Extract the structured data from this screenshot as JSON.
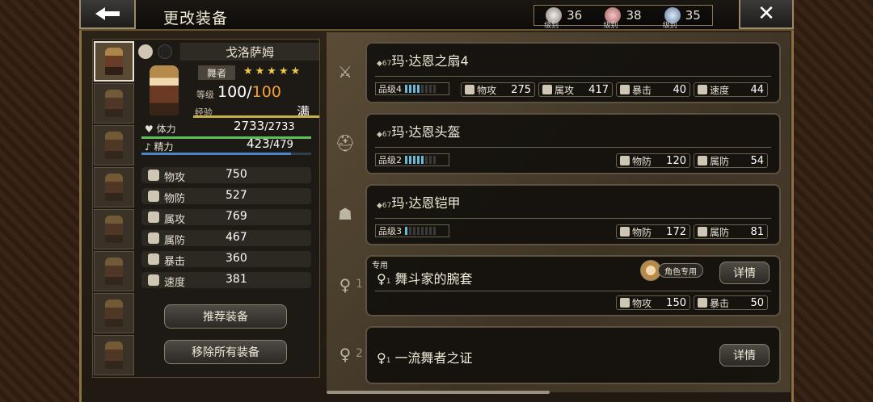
{
  "header": {
    "title": "更改装备",
    "back_icon": "back-arrow-icon",
    "close_icon": "close-icon",
    "levels": [
      {
        "caption": "级别",
        "value": "36"
      },
      {
        "caption": "级别",
        "value": "38"
      },
      {
        "caption": "级别",
        "value": "35"
      }
    ]
  },
  "character": {
    "name": "戈洛萨姆",
    "job": "舞者",
    "stars": "★★★★★",
    "level_label": "等级",
    "level": "100",
    "level_sep": "/",
    "level_max": "100",
    "exp_label": "经验",
    "exp_status": "满",
    "hp_label": "体力",
    "hp": "2733",
    "hp_max": "/2733",
    "mp_label": "精力",
    "mp": "423",
    "mp_max": "/479",
    "mp_fraction": 0.88
  },
  "stats": [
    {
      "label": "物攻",
      "value": "750"
    },
    {
      "label": "物防",
      "value": "527"
    },
    {
      "label": "属攻",
      "value": "769"
    },
    {
      "label": "属防",
      "value": "467"
    },
    {
      "label": "暴击",
      "value": "360"
    },
    {
      "label": "速度",
      "value": "381"
    }
  ],
  "buttons": {
    "recommend": "推荐装备",
    "remove_all": "移除所有装备"
  },
  "equipment": [
    {
      "level_tag": "67",
      "name": "玛·达恩之扇4",
      "grade_label": "品级4",
      "grade_pips": 4,
      "stats": [
        {
          "label": "物攻",
          "value": "275"
        },
        {
          "label": "属攻",
          "value": "417"
        },
        {
          "label": "暴击",
          "value": "40"
        },
        {
          "label": "速度",
          "value": "44"
        }
      ]
    },
    {
      "level_tag": "67",
      "name": "玛·达恩头盔",
      "grade_label": "品级2",
      "grade_pips": 5,
      "stats": [
        {
          "label": "物防",
          "value": "120"
        },
        {
          "label": "属防",
          "value": "54"
        }
      ]
    },
    {
      "level_tag": "67",
      "name": "玛·达恩铠甲",
      "grade_label": "品级3",
      "grade_pips": 1,
      "stats": [
        {
          "label": "物防",
          "value": "172"
        },
        {
          "label": "属防",
          "value": "81"
        }
      ]
    }
  ],
  "accessories": [
    {
      "slot": "1",
      "exclusive_tag": "专用",
      "level_tag": "1",
      "name": "舞斗家的腕套",
      "role_tag": "角色专用",
      "detail": "详情",
      "stats": [
        {
          "label": "物攻",
          "value": "150"
        },
        {
          "label": "暴击",
          "value": "50"
        }
      ]
    },
    {
      "slot": "2",
      "level_tag": "1",
      "name": "一流舞者之证",
      "detail": "详情"
    }
  ]
}
